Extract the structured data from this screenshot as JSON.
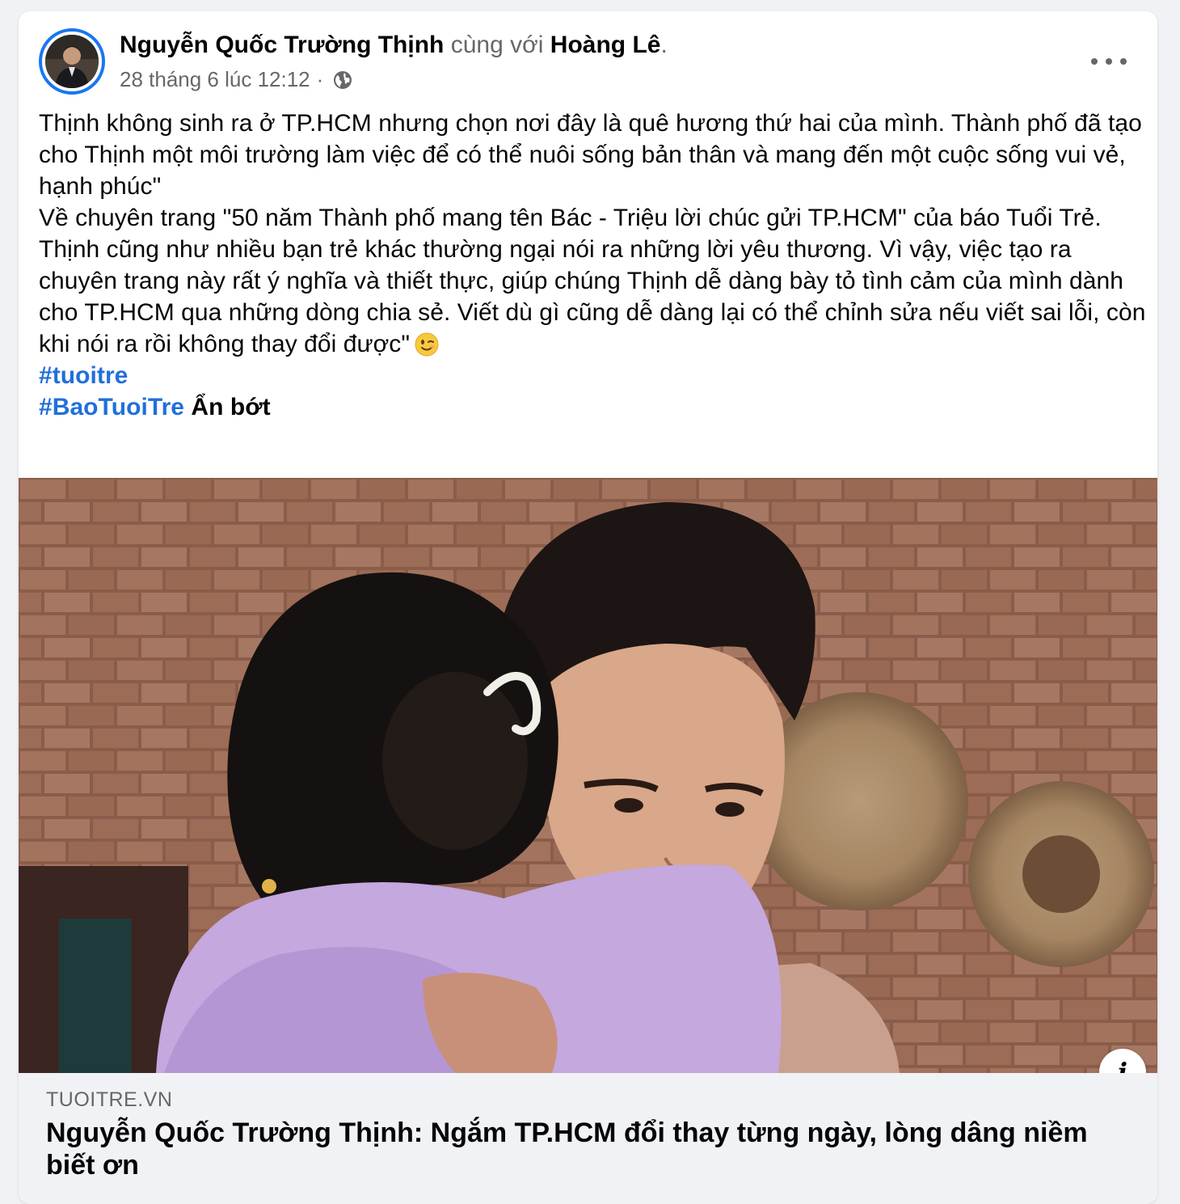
{
  "post": {
    "author": "Nguyễn Quốc Trường Thịnh",
    "with_text": "cùng với",
    "tagged": "Hoàng Lê",
    "tagged_suffix": ".",
    "timestamp": "28 tháng 6 lúc 12:12",
    "separator": "·",
    "privacy_icon": "globe-icon",
    "more_icon": "more-options-icon",
    "paragraphs": [
      "Thịnh không sinh ra ở TP.HCM nhưng chọn nơi đây là quê hương thứ hai của mình. Thành phố đã tạo cho Thịnh một môi trường làm việc để có thể nuôi sống bản thân và mang đến một cuộc sống vui vẻ, hạnh phúc\"",
      "Về  chuyên trang \"50 năm Thành phố mang tên Bác - Triệu lời chúc gửi TP.HCM\" của báo Tuổi Trẻ.",
      "Thịnh cũng như nhiều bạn trẻ khác thường ngại nói ra những lời yêu thương. Vì vậy, việc tạo ra chuyên trang này rất ý nghĩa và thiết thực, giúp chúng Thịnh dễ dàng bày tỏ tình cảm của mình dành cho TP.HCM qua những dòng chia sẻ. Viết dù gì cũng dễ dàng lại có thể chỉnh sửa nếu viết sai lỗi, còn khi nói ra rồi không thay đổi được\""
    ],
    "emoji": "winking-face-emoji",
    "hashtags": [
      "#tuoitre",
      "#BaoTuoiTre"
    ],
    "see_less": "Ẩn bớt"
  },
  "link_preview": {
    "domain": "TUOITRE.VN",
    "title": "Nguyễn Quốc Trường Thịnh: Ngắm TP.HCM đổi thay từng ngày, lòng dâng niềm biết ơn",
    "info_icon_label": "i"
  },
  "colors": {
    "accent": "#1877f2",
    "hashtag": "#216fdb",
    "secondary_text": "#65676b",
    "background": "#f0f2f5"
  }
}
